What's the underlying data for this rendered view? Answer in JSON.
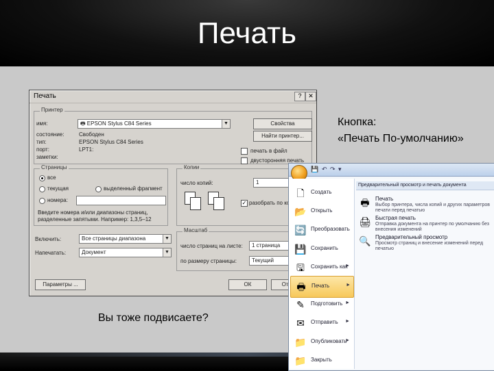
{
  "slide": {
    "title": "Печать",
    "caption_button_line1": "Кнопка:",
    "caption_button_line2": "«Печать По-умолчанию»",
    "caption_hang": "Вы тоже подвисаете?"
  },
  "dialog": {
    "title": "Печать",
    "help_btn": "?",
    "close_btn": "✕",
    "printer": {
      "group_label": "Принтер",
      "name_label": "имя:",
      "name_value": "EPSON Stylus C84 Series",
      "status_label": "состояние:",
      "status_value": "Свободен",
      "type_label": "тип:",
      "type_value": "EPSON Stylus C84 Series",
      "port_label": "порт:",
      "port_value": "LPT1:",
      "notes_label": "заметки:",
      "properties_btn": "Свойства",
      "find_btn": "Найти принтер...",
      "print_to_file": "печать в файл",
      "duplex": "двусторонняя печать"
    },
    "pages": {
      "group_label": "Страницы",
      "all": "все",
      "current": "текущая",
      "selection": "выделенный фрагмент",
      "range": "номера:",
      "hint_line1": "Введите номера и/или диапазоны страниц,",
      "hint_line2": "разделенные запятыми. Например: 1,3,5–12"
    },
    "copies": {
      "group_label": "Копии",
      "count_label": "число копий:",
      "count_value": "1",
      "collate": "разобрать по копиям"
    },
    "print_what_label": "Включить:",
    "print_what_value": "Все страницы диапазона",
    "print_label": "Напечатать:",
    "print_value": "Документ",
    "scale": {
      "group_label": "Масштаб",
      "pages_per_sheet_label": "число страниц на листе:",
      "pages_per_sheet_value": "1 страница",
      "fit_label": "по размеру страницы:",
      "fit_value": "Текущий"
    },
    "options_btn": "Параметры ...",
    "ok_btn": "ОК",
    "cancel_btn": "Отмена",
    "dropdown_arrow": "▼"
  },
  "office_menu": {
    "left_items": [
      {
        "label": "Создать",
        "icon": "new-doc-icon",
        "glyph": "🗋",
        "arrow": ""
      },
      {
        "label": "Открыть",
        "icon": "open-folder-icon",
        "glyph": "📂",
        "arrow": ""
      },
      {
        "label": "Преобразовать",
        "icon": "convert-icon",
        "glyph": "🔄",
        "arrow": ""
      },
      {
        "label": "Сохранить",
        "icon": "save-icon",
        "glyph": "💾",
        "arrow": ""
      },
      {
        "label": "Сохранить как",
        "icon": "save-as-icon",
        "glyph": "🖫",
        "arrow": "►"
      },
      {
        "label": "Печать",
        "icon": "print-icon",
        "glyph": "🖶",
        "arrow": "►"
      },
      {
        "label": "Подготовить",
        "icon": "prepare-icon",
        "glyph": "✎",
        "arrow": "►"
      },
      {
        "label": "Отправить",
        "icon": "send-icon",
        "glyph": "✉",
        "arrow": "►"
      },
      {
        "label": "Опубликовать",
        "icon": "publish-icon",
        "glyph": "📁",
        "arrow": "►"
      },
      {
        "label": "Закрыть",
        "icon": "close-folder-icon",
        "glyph": "📁",
        "arrow": ""
      }
    ],
    "selected_index": 5,
    "right_header": "Предварительный просмотр и печать документа",
    "right_items": [
      {
        "title": "Печать",
        "desc": "Выбор принтера, числа копий и других параметров печати перед печатью",
        "icon": "printer-icon",
        "glyph": "🖶"
      },
      {
        "title": "Быстрая печать",
        "desc": "Отправка документа на принтер по умолчанию без внесения изменений",
        "icon": "quick-print-icon",
        "glyph": "🖨"
      },
      {
        "title": "Предварительный просмотр",
        "desc": "Просмотр страниц и внесение изменений перед печатью",
        "icon": "preview-icon",
        "glyph": "🔍"
      }
    ],
    "qat": {
      "undo": "↶",
      "redo": "↷",
      "more": "▾"
    }
  }
}
